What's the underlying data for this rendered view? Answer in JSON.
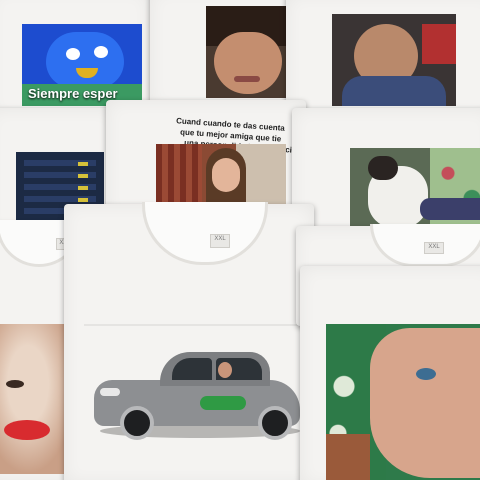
{
  "scene": {
    "colors": {
      "background": "#6b625d",
      "shirt": "#f4f3f1",
      "print_blue": "#1a4fd0",
      "car_gray": "#8d8f92",
      "car_logo_green": "#2f9a44"
    },
    "prints": {
      "blue_character_caption": "Siempre esper",
      "text_over_photo_line1": "Cuand cuando te das cuenta",
      "text_over_photo_line2": "que tu mejor amiga que tie",
      "text_over_photo_line3": "una personalidad como pacie",
      "shirt_tag_1": "XXL",
      "shirt_tag_2": "XXL",
      "shirt_tag_3": "XXL"
    }
  }
}
